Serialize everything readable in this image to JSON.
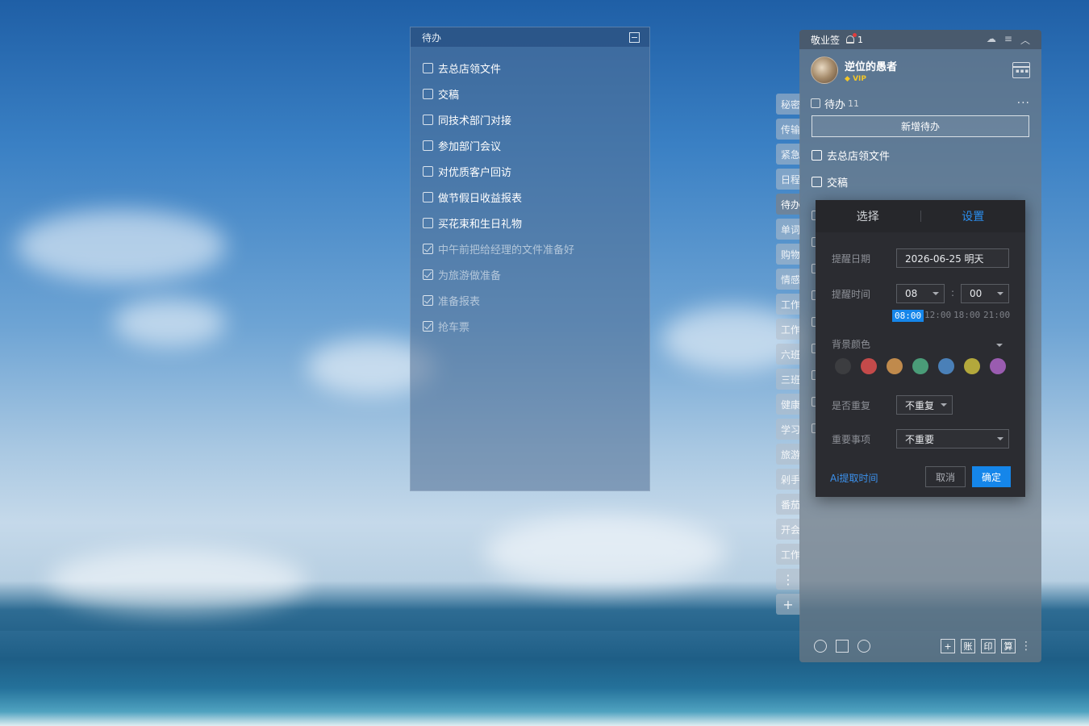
{
  "todo_panel": {
    "title": "待办",
    "items": [
      {
        "text": "去总店领文件",
        "done": false
      },
      {
        "text": "交稿",
        "done": false
      },
      {
        "text": "同技术部门对接",
        "done": false
      },
      {
        "text": "参加部门会议",
        "done": false
      },
      {
        "text": "对优质客户回访",
        "done": false
      },
      {
        "text": "做节假日收益报表",
        "done": false
      },
      {
        "text": "买花束和生日礼物",
        "done": false
      },
      {
        "text": "中午前把给经理的文件准备好",
        "done": true
      },
      {
        "text": "为旅游做准备",
        "done": true
      },
      {
        "text": "准备报表",
        "done": true
      },
      {
        "text": "抢车票",
        "done": true
      }
    ]
  },
  "side_tabs": [
    "秘密",
    "传输",
    "紧急",
    "日程",
    "待办",
    "单词",
    "购物",
    "情感",
    "工作",
    "工作",
    "六班",
    "三班",
    "健康",
    "学习",
    "旅游",
    "剁手",
    "番茄",
    "开会",
    "工作"
  ],
  "side_tab_more": "⋮",
  "side_tab_add": "+",
  "app": {
    "title": "敬业签",
    "notify_count": "1",
    "user_name": "逆位的愚者",
    "vip_label": "VIP",
    "section_title": "待办",
    "section_count": "11",
    "add_button": "新增待办",
    "items": [
      "去总店领文件",
      "交稿"
    ],
    "footer_buttons": [
      "+",
      "账",
      "印",
      "算"
    ]
  },
  "popup": {
    "tab_select": "选择",
    "tab_settings": "设置",
    "label_date": "提醒日期",
    "date_value": "2026-06-25 明天",
    "label_time": "提醒时间",
    "hour": "08",
    "minute": "00",
    "time_sep": ":",
    "quick_times": [
      "08:00",
      "12:00",
      "18:00",
      "21:00"
    ],
    "label_color": "背景颜色",
    "colors": [
      "#3c3d40",
      "#c44a4a",
      "#c08a4c",
      "#4a9c78",
      "#4a80b8",
      "#b3a83c",
      "#9a5cb0"
    ],
    "label_repeat": "是否重复",
    "repeat_value": "不重复",
    "label_important": "重要事项",
    "important_value": "不重要",
    "ai_link": "Ai提取时间",
    "cancel": "取消",
    "confirm": "确定"
  }
}
